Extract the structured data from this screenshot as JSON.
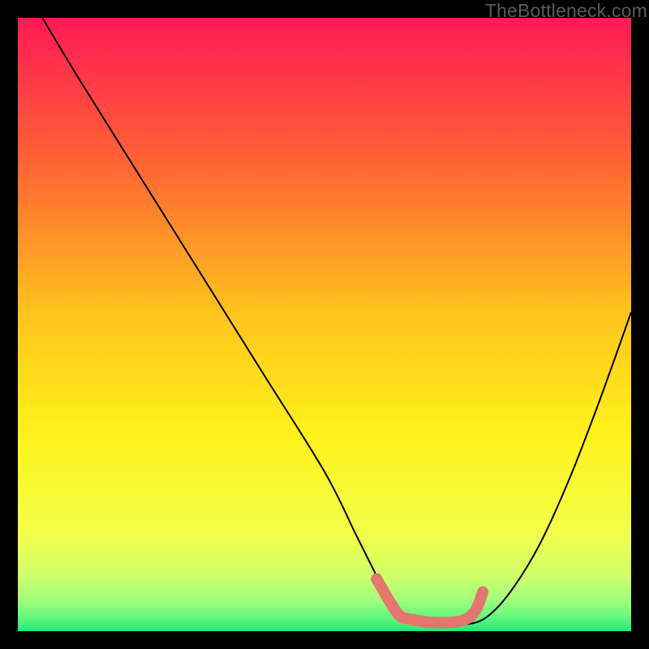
{
  "watermark": "TheBottleneck.com",
  "colors": {
    "bg": "#000000",
    "curve": "#000000",
    "marker": "#e4766f",
    "gradient_top": "#ff1a55",
    "gradient_mid1": "#ff8f28",
    "gradient_mid2": "#ffe81e",
    "gradient_mid3": "#faff4d",
    "gradient_mid4": "#d2ff70",
    "gradient_bottom": "#21e87a"
  },
  "chart_data": {
    "type": "line",
    "title": "",
    "xlabel": "",
    "ylabel": "",
    "xlim": [
      0,
      100
    ],
    "ylim": [
      0,
      100
    ],
    "series": [
      {
        "name": "bottleneck-curve",
        "x": [
          4,
          10,
          20,
          30,
          40,
          50,
          55,
          58,
          60,
          64,
          68,
          72,
          76,
          80,
          85,
          90,
          95,
          100
        ],
        "y": [
          100,
          90,
          74,
          58,
          42,
          26,
          16,
          10,
          6,
          2,
          1,
          1,
          2,
          6,
          14,
          25,
          38,
          52
        ]
      }
    ],
    "markers": {
      "name": "highlighted-range",
      "x": [
        58.5,
        62,
        64,
        66,
        68,
        70,
        72,
        73.5,
        74.5,
        75.2,
        75.8
      ],
      "y": [
        8.5,
        2.8,
        2.0,
        1.6,
        1.4,
        1.4,
        1.6,
        2.2,
        3.2,
        4.6,
        6.4
      ]
    },
    "gradient_stops": [
      {
        "pct": 0,
        "color": "#ff1a55"
      },
      {
        "pct": 24,
        "color": "#ff6534"
      },
      {
        "pct": 48,
        "color": "#ffc31d"
      },
      {
        "pct": 68,
        "color": "#fff21c"
      },
      {
        "pct": 84,
        "color": "#f2ff4a"
      },
      {
        "pct": 91,
        "color": "#cfff6b"
      },
      {
        "pct": 95,
        "color": "#a0ff7c"
      },
      {
        "pct": 98,
        "color": "#5cf77e"
      },
      {
        "pct": 100,
        "color": "#21e87a"
      }
    ]
  }
}
